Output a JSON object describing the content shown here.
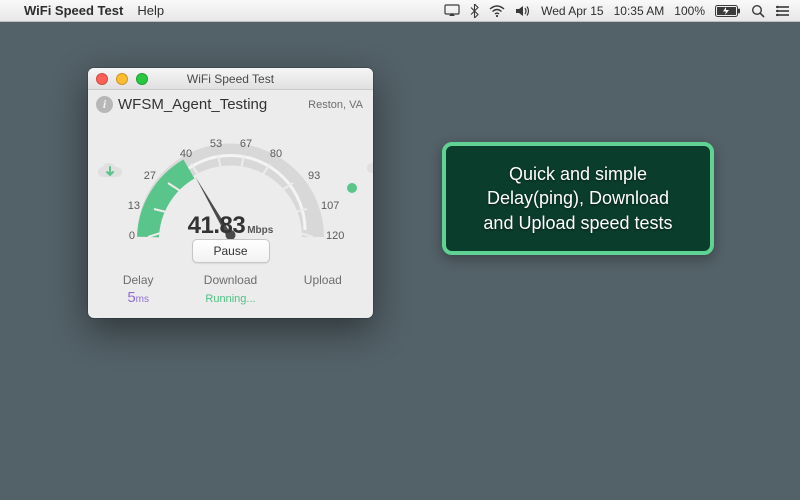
{
  "menubar": {
    "app_name": "WiFi Speed Test",
    "menu_help": "Help",
    "date": "Wed Apr 15",
    "time": "10:35 AM",
    "battery_pct": "100%"
  },
  "window": {
    "title": "WiFi Speed Test",
    "ssid": "WFSM_Agent_Testing",
    "location": "Reston, VA",
    "gauge": {
      "ticks": [
        "0",
        "13",
        "27",
        "40",
        "53",
        "67",
        "80",
        "93",
        "107",
        "120"
      ],
      "value": "41.83",
      "unit": "Mbps"
    },
    "pause_label": "Pause",
    "stats": {
      "delay_label": "Delay",
      "delay_value": "5",
      "delay_unit": "ms",
      "download_label": "Download",
      "download_value": "Running...",
      "upload_label": "Upload",
      "upload_value": ""
    }
  },
  "promo": {
    "line1": "Quick and simple",
    "line2": "Delay(ping), Download",
    "line3": "and Upload speed tests"
  },
  "colors": {
    "accent_green": "#5ac58a",
    "promo_border": "#60d394",
    "promo_bg": "#0b3d2c",
    "desktop": "#536168"
  }
}
